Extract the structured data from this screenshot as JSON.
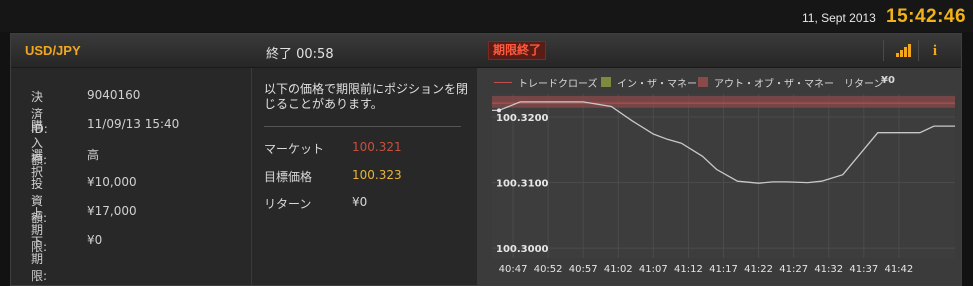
{
  "top": {
    "date": "11, Sept 2013",
    "time": "15:42:46"
  },
  "header": {
    "pair": "USD/JPY",
    "expiry": "終了  00:58",
    "badge": "期限終了"
  },
  "details": [
    {
      "label": "決済ID:",
      "value": "9040160"
    },
    {
      "label": "購入額:",
      "value": "11/09/13 15:40"
    },
    {
      "label": "選択",
      "value": "高"
    },
    {
      "label": "投資額:",
      "value": "¥10,000"
    },
    {
      "label": "上期限:",
      "value": "¥17,000"
    },
    {
      "label": "下期限:",
      "value": "¥0"
    }
  ],
  "notice": "以下の価格で期限前にポジションを閉じることがあります。",
  "prices": [
    {
      "label": "マーケット",
      "value": "100.321",
      "color": "#c8503c"
    },
    {
      "label": "目標価格",
      "value": "100.323",
      "color": "#e8b43a"
    },
    {
      "label": "リターン",
      "value": "¥0",
      "color": "#d8d8d8"
    }
  ],
  "legend": {
    "trade_close": "トレードクローズ",
    "in_the_money": "イン・ザ・マネー",
    "out_of_the_money": "アウト・オブ・ザ・マネー",
    "return_label": "リターン",
    "return_value": "¥0"
  },
  "colors": {
    "accent": "#f2b21a",
    "in_money": "#7c8c3c",
    "out_money": "#8a4a4a",
    "line": "#c8c8c8"
  },
  "chart_data": {
    "type": "line",
    "x_ticks": [
      "40:47",
      "40:52",
      "40:57",
      "41:02",
      "41:07",
      "41:12",
      "41:17",
      "41:22",
      "41:27",
      "41:32",
      "41:37",
      "41:42"
    ],
    "y_ticks": [
      "100.3200",
      "100.3100",
      "100.3000"
    ],
    "ylim": [
      100.2985,
      100.3235
    ],
    "x_start_seconds": 2444,
    "x_end_seconds": 2510,
    "out_of_money_band": [
      100.3214,
      100.3232
    ],
    "trade_close_level": 100.3221,
    "series": [
      {
        "t": [
          2444,
          2445,
          2448,
          2457,
          2461,
          2464,
          2467,
          2469,
          2471,
          2474,
          2476,
          2479,
          2482,
          2484,
          2486,
          2489,
          2491,
          2494,
          2499,
          2505,
          2507,
          2510
        ],
        "v": [
          100.321,
          100.321,
          100.3223,
          100.3223,
          100.3216,
          100.3194,
          100.3174,
          100.3166,
          100.316,
          100.314,
          100.312,
          100.3102,
          100.3099,
          100.3101,
          100.3101,
          100.31,
          100.3102,
          100.3112,
          100.3176,
          100.3176,
          100.3186,
          100.3186
        ]
      }
    ]
  }
}
